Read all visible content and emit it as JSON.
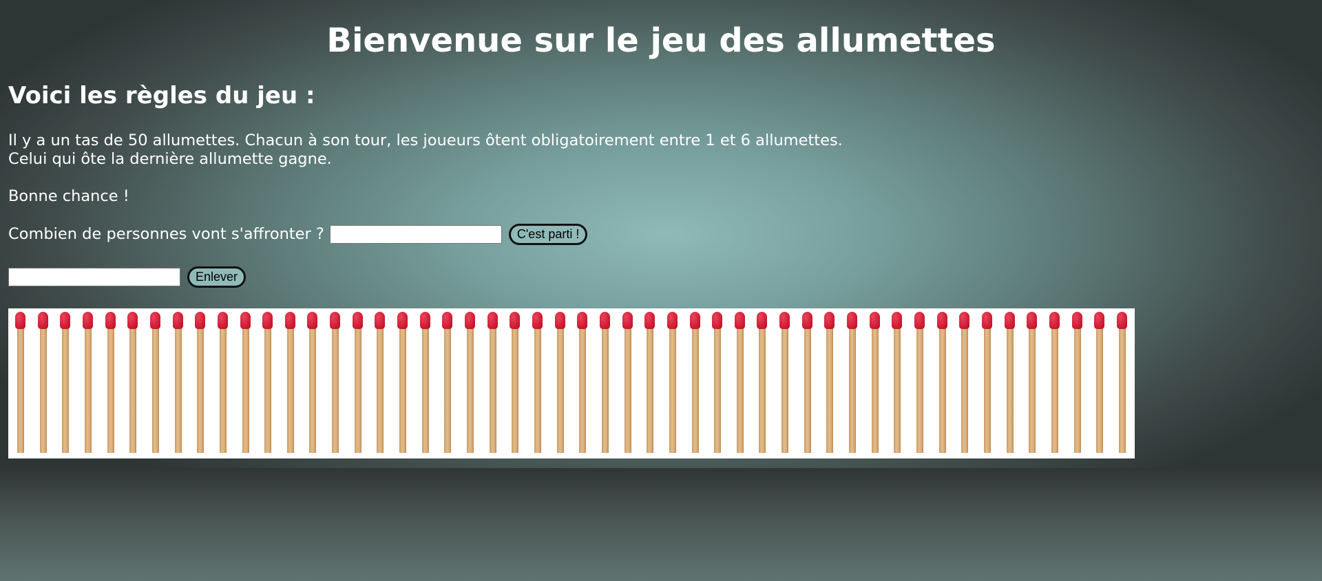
{
  "title": "Bienvenue sur le jeu des allumettes",
  "rules_heading": "Voici les règles du jeu :",
  "rules": {
    "line1": "Il y a un tas de 50 allumettes. Chacun à son tour, les joueurs ôtent obligatoirement entre 1 et 6 allumettes.",
    "line2": "Celui qui ôte la dernière allumette gagne."
  },
  "good_luck": "Bonne chance !",
  "players": {
    "label": "Combien de personnes vont s'affronter ?",
    "input_value": "",
    "button_label": "C'est parti !"
  },
  "remove": {
    "input_value": "",
    "button_label": "Enlever"
  },
  "matches": {
    "count": 50,
    "icon": "match-icon",
    "head_color": "#d42038",
    "stick_color": "#e4bd8a"
  },
  "colors": {
    "background_center": "#8fbab8",
    "background_edge": "#2e3535",
    "button_bg": "#8fbab8",
    "text": "#ffffff"
  }
}
